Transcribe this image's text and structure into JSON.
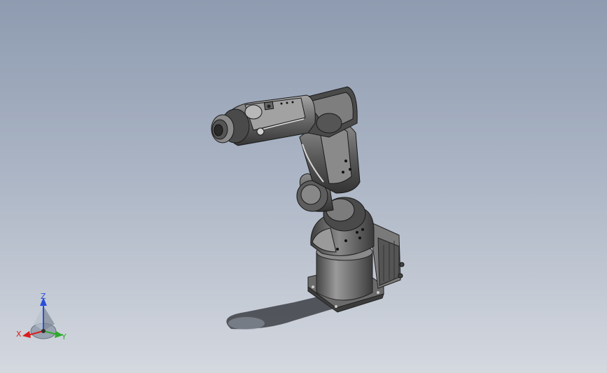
{
  "viewport": {
    "background_top": "#8e9bb0",
    "background_bottom": "#d4d8df",
    "model": "robot-arm-6-axis"
  },
  "triad": {
    "x_label": "X",
    "y_label": "Y",
    "z_label": "Z",
    "x_color": "#d81e1e",
    "y_color": "#2faa2f",
    "z_color": "#2b4fd8"
  }
}
